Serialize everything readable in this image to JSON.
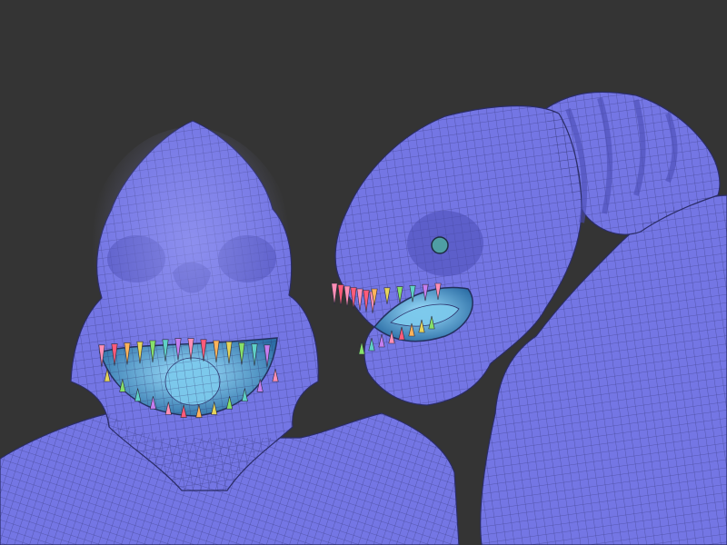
{
  "viewport": {
    "background_color": "#343434",
    "views": [
      {
        "view": "front"
      },
      {
        "view": "side"
      }
    ]
  },
  "colors": {
    "mesh_fill": "#7476e4",
    "mesh_shadow": "#4b4db4",
    "mesh_highlight": "#a2a4f6",
    "wireframe": "#2a2c66",
    "mouth_interior": "#3a7fb8",
    "tongue": "#7cc9ec",
    "eye": "#4f9ea4",
    "teeth": [
      "#ff8fb6",
      "#ff5b7a",
      "#ffb35b",
      "#e6d45a",
      "#86e06a",
      "#5fd0c6",
      "#c57ef0"
    ]
  }
}
